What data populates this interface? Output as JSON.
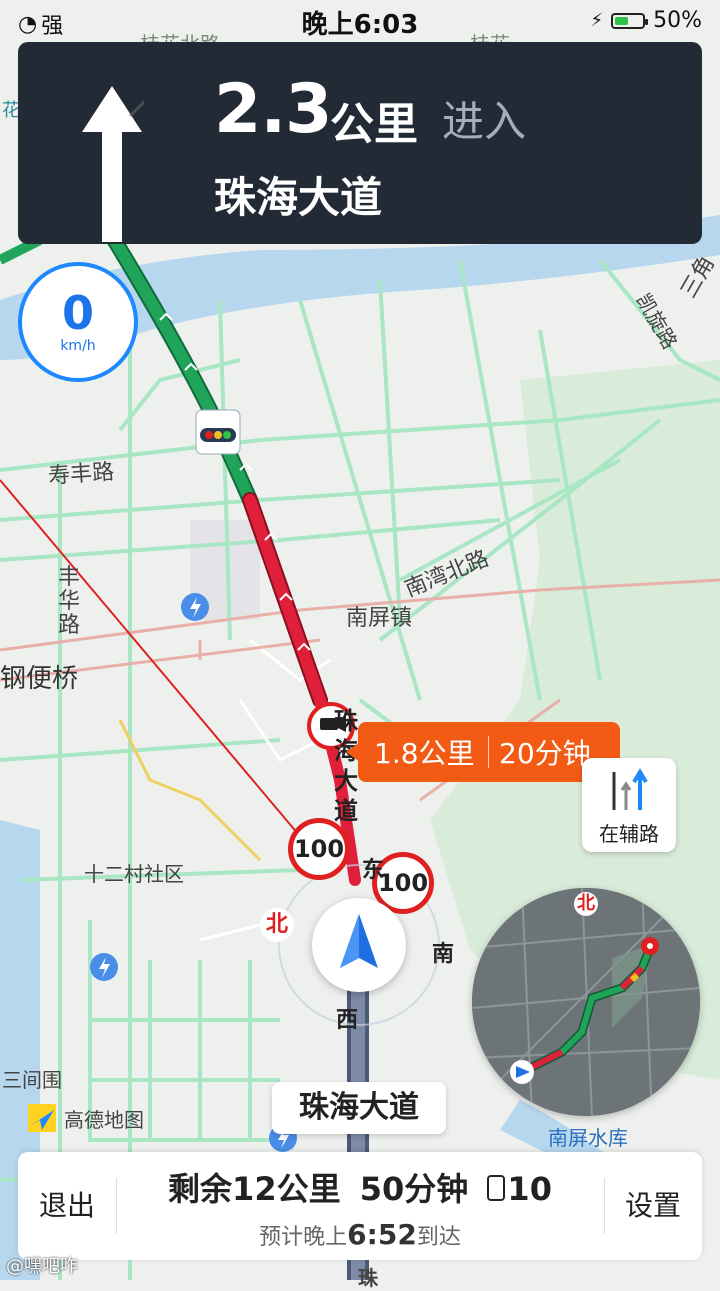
{
  "status_bar": {
    "signal": "强",
    "time": "晚上6:03",
    "battery": "50%",
    "battery_level": 0.5
  },
  "nav": {
    "distance": "2.3",
    "unit": "公里",
    "action": "进入",
    "road": "珠海大道",
    "turn_icon": "straight-arrow-icon"
  },
  "speed": {
    "value": "0",
    "unit": "km/h"
  },
  "segment": {
    "distance": "1.8公里",
    "time": "20分钟"
  },
  "side_road": {
    "label": "在辅路"
  },
  "speed_limits": [
    "100",
    "100"
  ],
  "compass": {
    "north": "北",
    "east": "东",
    "south": "南",
    "west": "西"
  },
  "current_road": "珠海大道",
  "map_labels": {
    "shoufeng": "寿丰路",
    "fenghua": "丰华路",
    "gangbian": "钢便桥",
    "nanwan": "南湾北路",
    "nanping": "南屏镇",
    "shiercun": "十二村社区",
    "sanjianwei": "三间围",
    "zhuhai_vert": "珠海大道",
    "guifa": "桂花北路",
    "guifa2": "桂花",
    "hua": "花",
    "sanjiao": "三角",
    "dao": "道",
    "kaixuan": "凯旋路",
    "zhu_bottom": "珠"
  },
  "minimap": {
    "north": "北",
    "reservoir": "南屏水库"
  },
  "logo": {
    "text": "高德地图"
  },
  "bottom_bar": {
    "exit": "退出",
    "settings": "设置",
    "remaining_prefix": "剩余",
    "remaining_distance": "12公里",
    "remaining_time": "50分钟",
    "traffic_lights": "10",
    "eta_prefix": "预计晚上",
    "eta_time": "6:52",
    "eta_suffix": "到达"
  },
  "watermark": "@嘿吧咋",
  "colors": {
    "route_green": "#1fa45a",
    "route_red": "#e0203a",
    "nav_bg": "#222a35",
    "accent": "#1e88ff",
    "bubble": "#f35a14"
  }
}
